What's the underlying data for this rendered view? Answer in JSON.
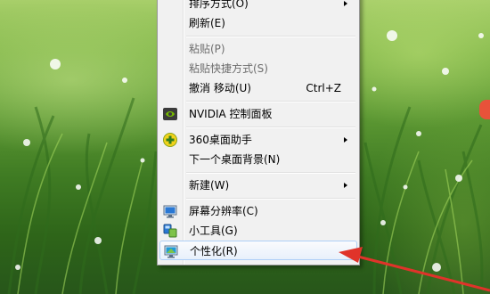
{
  "context_menu": {
    "items": [
      {
        "label": "排序方式(O)",
        "icon": "",
        "submenu": true,
        "disabled": false
      },
      {
        "label": "刷新(E)",
        "icon": "",
        "submenu": false,
        "disabled": false
      },
      {
        "label": "粘贴(P)",
        "icon": "",
        "submenu": false,
        "disabled": true
      },
      {
        "label": "粘贴快捷方式(S)",
        "icon": "",
        "submenu": false,
        "disabled": true
      },
      {
        "label": "撤消 移动(U)",
        "accel": "Ctrl+Z",
        "icon": "",
        "submenu": false,
        "disabled": false
      },
      {
        "label": "NVIDIA 控制面板",
        "icon": "nvidia-icon",
        "submenu": false,
        "disabled": false
      },
      {
        "label": "360桌面助手",
        "icon": "360-plus-icon",
        "submenu": true,
        "disabled": false
      },
      {
        "label": "下一个桌面背景(N)",
        "icon": "",
        "submenu": false,
        "disabled": false
      },
      {
        "label": "新建(W)",
        "icon": "",
        "submenu": true,
        "disabled": false
      },
      {
        "label": "屏幕分辨率(C)",
        "icon": "display-icon",
        "submenu": false,
        "disabled": false
      },
      {
        "label": "小工具(G)",
        "icon": "gadgets-icon",
        "submenu": false,
        "disabled": false
      },
      {
        "label": "个性化(R)",
        "icon": "personalize-icon",
        "submenu": false,
        "disabled": false,
        "highlighted": true
      }
    ]
  },
  "colors": {
    "annotation_arrow": "#e0332a",
    "highlight_border": "#aecff7",
    "menu_background": "#f1f1f1"
  }
}
